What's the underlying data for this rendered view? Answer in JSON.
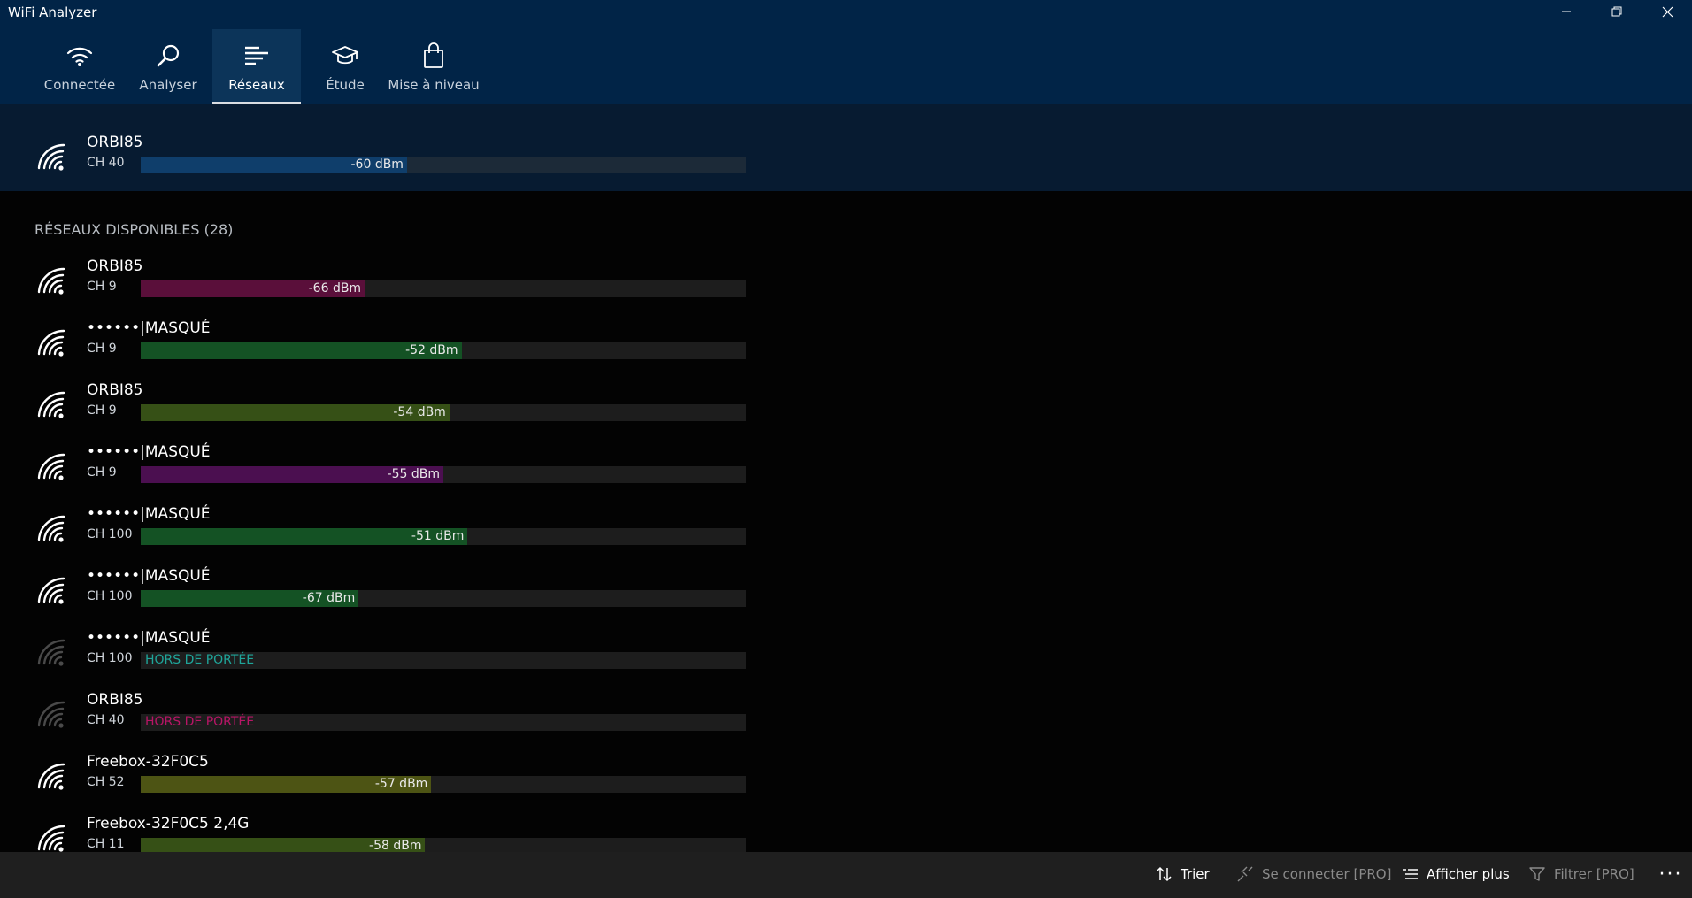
{
  "window": {
    "title": "WiFi Analyzer"
  },
  "tabs": [
    {
      "label": "Connectée",
      "icon": "wifi-icon",
      "active": false
    },
    {
      "label": "Analyser",
      "icon": "magnifier-icon",
      "active": false
    },
    {
      "label": "Réseaux",
      "icon": "list-icon",
      "active": true
    },
    {
      "label": "Étude",
      "icon": "graduation-cap-icon",
      "active": false
    },
    {
      "label": "Mise à niveau",
      "icon": "shopping-bag-icon",
      "active": false
    }
  ],
  "connected": {
    "ssid": "ORBI85",
    "channel": "CH 40",
    "signal": "-60 dBm",
    "level": 0.44,
    "color": "#0f3e6b"
  },
  "available": {
    "title": "RÉSEAUX DISPONIBLES (28)",
    "networks": [
      {
        "ssid": "ORBI85",
        "channel": "CH 9",
        "signal": "-66 dBm",
        "level": 0.37,
        "color": "#5a0f3a",
        "in_range": true
      },
      {
        "ssid": "••••••|MASQUÉ",
        "channel": "CH 9",
        "signal": "-52 dBm",
        "level": 0.53,
        "color": "#145224",
        "in_range": true
      },
      {
        "ssid": "ORBI85",
        "channel": "CH 9",
        "signal": "-54 dBm",
        "level": 0.51,
        "color": "#365016",
        "in_range": true
      },
      {
        "ssid": "••••••|MASQUÉ",
        "channel": "CH 9",
        "signal": "-55 dBm",
        "level": 0.5,
        "color": "#4b0f50",
        "in_range": true
      },
      {
        "ssid": "••••••|MASQUÉ",
        "channel": "CH 100",
        "signal": "-51 dBm",
        "level": 0.54,
        "color": "#145224",
        "in_range": true
      },
      {
        "ssid": "••••••|MASQUÉ",
        "channel": "CH 100",
        "signal": "-67 dBm",
        "level": 0.36,
        "color": "#145224",
        "in_range": true
      },
      {
        "ssid": "••••••|MASQUÉ",
        "channel": "CH 100",
        "signal": "HORS DE PORTÉE",
        "level": 0,
        "color": "#1fa59a",
        "in_range": false
      },
      {
        "ssid": "ORBI85",
        "channel": "CH 40",
        "signal": "HORS DE PORTÉE",
        "level": 0,
        "color": "#b81566",
        "in_range": false
      },
      {
        "ssid": "Freebox-32F0C5",
        "channel": "CH 52",
        "signal": "-57 dBm",
        "level": 0.48,
        "color": "#4d5414",
        "in_range": true
      },
      {
        "ssid": "Freebox-32F0C5 2,4G",
        "channel": "CH 11",
        "signal": "-58 dBm",
        "level": 0.47,
        "color": "#365016",
        "in_range": true
      }
    ]
  },
  "commands": [
    {
      "label": "Trier",
      "icon": "sort-icon",
      "enabled": true
    },
    {
      "label": "Se connecter [PRO]",
      "icon": "connect-icon",
      "enabled": false
    },
    {
      "label": "Afficher plus",
      "icon": "list-more-icon",
      "enabled": true
    },
    {
      "label": "Filtrer [PRO]",
      "icon": "filter-icon",
      "enabled": false
    }
  ],
  "more_label": "···"
}
